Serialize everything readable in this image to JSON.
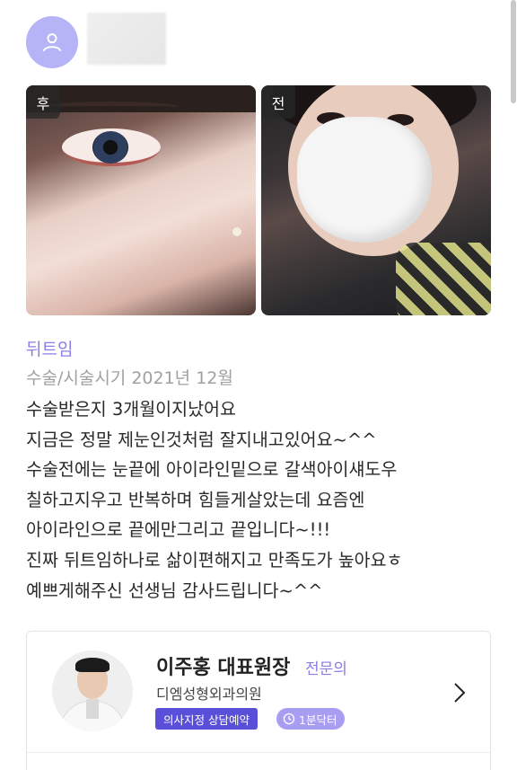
{
  "review": {
    "photos": [
      {
        "tag": "후"
      },
      {
        "tag": "전"
      }
    ],
    "category": "뒤트임",
    "surgery_date": "수술/시술시기 2021년 12월",
    "lines": [
      "수술받은지 3개월이지났어요",
      "지금은 정말 제눈인것처럼 잘지내고있어요~^^",
      "수술전에는 눈끝에 아이라인밑으로 갈색아이섀도우",
      "칠하고지우고 반복하며 힘들게살았는데 요즘엔",
      "아이라인으로 끝에만그리고 끝입니다~!!!",
      "진짜 뒤트임하나로 삶이편해지고 만족도가 높아요ㅎ",
      "예쁘게해주신 선생님 감사드립니다~^^"
    ]
  },
  "doctor": {
    "name": "이주홍 대표원장",
    "specialist": "전문의",
    "clinic": "디엠성형외과의원",
    "badge_designated": "의사지정 상담예약",
    "badge_oneminute": "1분닥터"
  },
  "icons": {
    "avatar": "user-icon",
    "badge_oneminute": "clock-icon",
    "card_link": "chevron-right-icon"
  },
  "colors": {
    "accent": "#8a7de6",
    "avatar_bg": "#b4b4f7",
    "badge_designated": "#5a4fd8",
    "badge_oneminute": "#a79ef2"
  }
}
